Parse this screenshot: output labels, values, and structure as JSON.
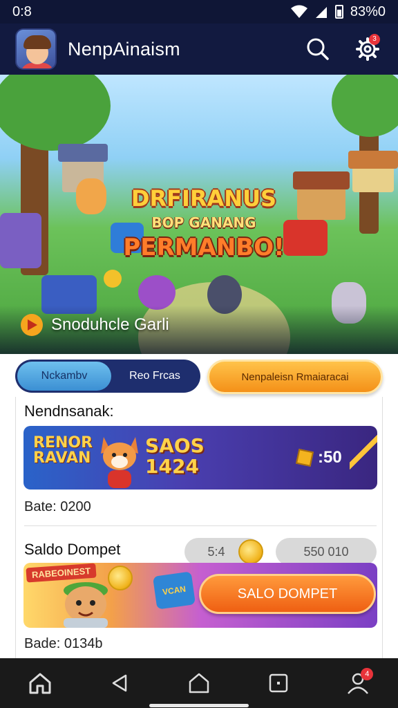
{
  "status": {
    "time": "0:8",
    "battery": "83%0"
  },
  "header": {
    "title": "NenpAinaism",
    "search_icon": "search-icon",
    "settings_icon": "gear-icon",
    "notification_count": "3"
  },
  "hero": {
    "title_line1": "DRFIRANUS",
    "title_line2": "BOP GANANG",
    "title_line3": "PERMANBO!",
    "caption": "Snoduhcle Garli"
  },
  "tabs": {
    "active": "Nckambv",
    "inactive": "Reo Frcas",
    "action": "Nenpaleisn Rmaiaracai"
  },
  "section1": {
    "title": "Nendnsanak:",
    "promo_logo_1": "RENOR",
    "promo_logo_2": "RAVAN",
    "promo_big_1": "SAOS",
    "promo_big_2": "1424",
    "coin_value": ":50",
    "meta": "Bate: 0200"
  },
  "section2": {
    "title": "Saldo Dompet",
    "pill_left": "5:4",
    "pill_right": "550 010",
    "tag": "RABEOINEST",
    "sign": "VCAN",
    "cta": "SALO DOMPET",
    "meta": "Bade: 0134b"
  },
  "bottom_nav": {
    "profile_badge": "4"
  },
  "colors": {
    "primary_dark": "#0f1636",
    "accent_orange": "#f49018",
    "accent_blue": "#3b8fd3"
  }
}
